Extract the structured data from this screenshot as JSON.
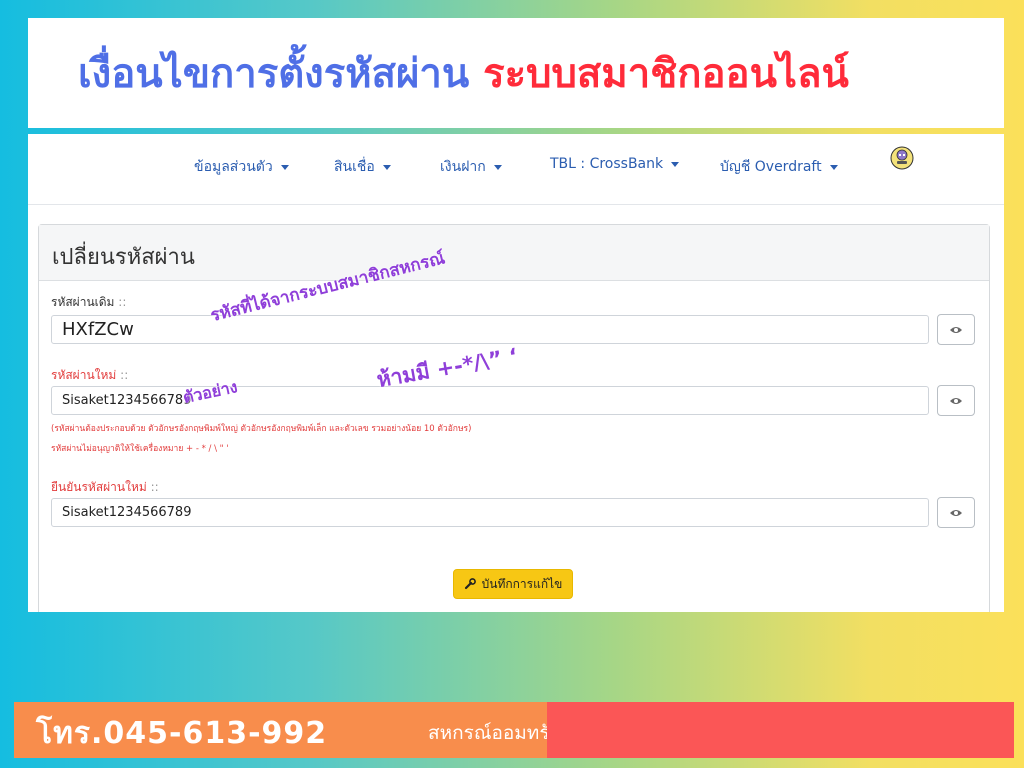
{
  "banner": {
    "title_part1": "เงื่อนไขการตั้งรหัสผ่าน",
    "title_part2": "ระบบสมาชิกออนไลน์",
    "colors": {
      "blue": "#4f6fe6",
      "red": "#ff2b3a"
    }
  },
  "nav": {
    "items": [
      {
        "label": "ข้อมูลส่วนตัว"
      },
      {
        "label": "สินเชื่อ"
      },
      {
        "label": "เงินฝาก"
      },
      {
        "label": "TBL : CrossBank"
      },
      {
        "label": "บัญชี Overdraft"
      }
    ],
    "avatar_icon": "user-avatar-icon"
  },
  "panel": {
    "title": "เปลี่ยนรหัสผ่าน",
    "old_password": {
      "label": "รหัสผ่านเดิม",
      "suffix": " ::",
      "value": "HXfZCw"
    },
    "new_password": {
      "label": "รหัสผ่านใหม่",
      "suffix": " ::",
      "value": "Sisaket1234566789"
    },
    "confirm_password": {
      "label": "ยืนยันรหัสผ่านใหม่",
      "suffix": " ::",
      "value": "Sisaket1234566789"
    },
    "hint1": "(รหัสผ่านต้องประกอบด้วย ตัวอักษรอังกฤษพิมพ์ใหญ่ ตัวอักษรอังกฤษพิมพ์เล็ก และตัวเลข รวมอย่างน้อย 10 ตัวอักษร)",
    "hint2": "รหัสผ่านไม่อนุญาติให้ใช้เครื่องหมาย + - * / \\ \" '",
    "save_label": "บันทึกการแก้ไข",
    "eye_icon": "eye-icon",
    "wrench_icon": "wrench-icon"
  },
  "annotations": {
    "coop_password": "รหัสที่ได้จากระบบสมาชิกสหกรณ์",
    "example": "ตัวอย่าง",
    "forbidden": "ห้ามมี +-*/\\” ‘"
  },
  "footer": {
    "phone": "โทร.045-613-992",
    "coop_name": "สหกรณ์ออมทรัพย์สาธารณสุขศรีสะเกษ จำกัด"
  }
}
